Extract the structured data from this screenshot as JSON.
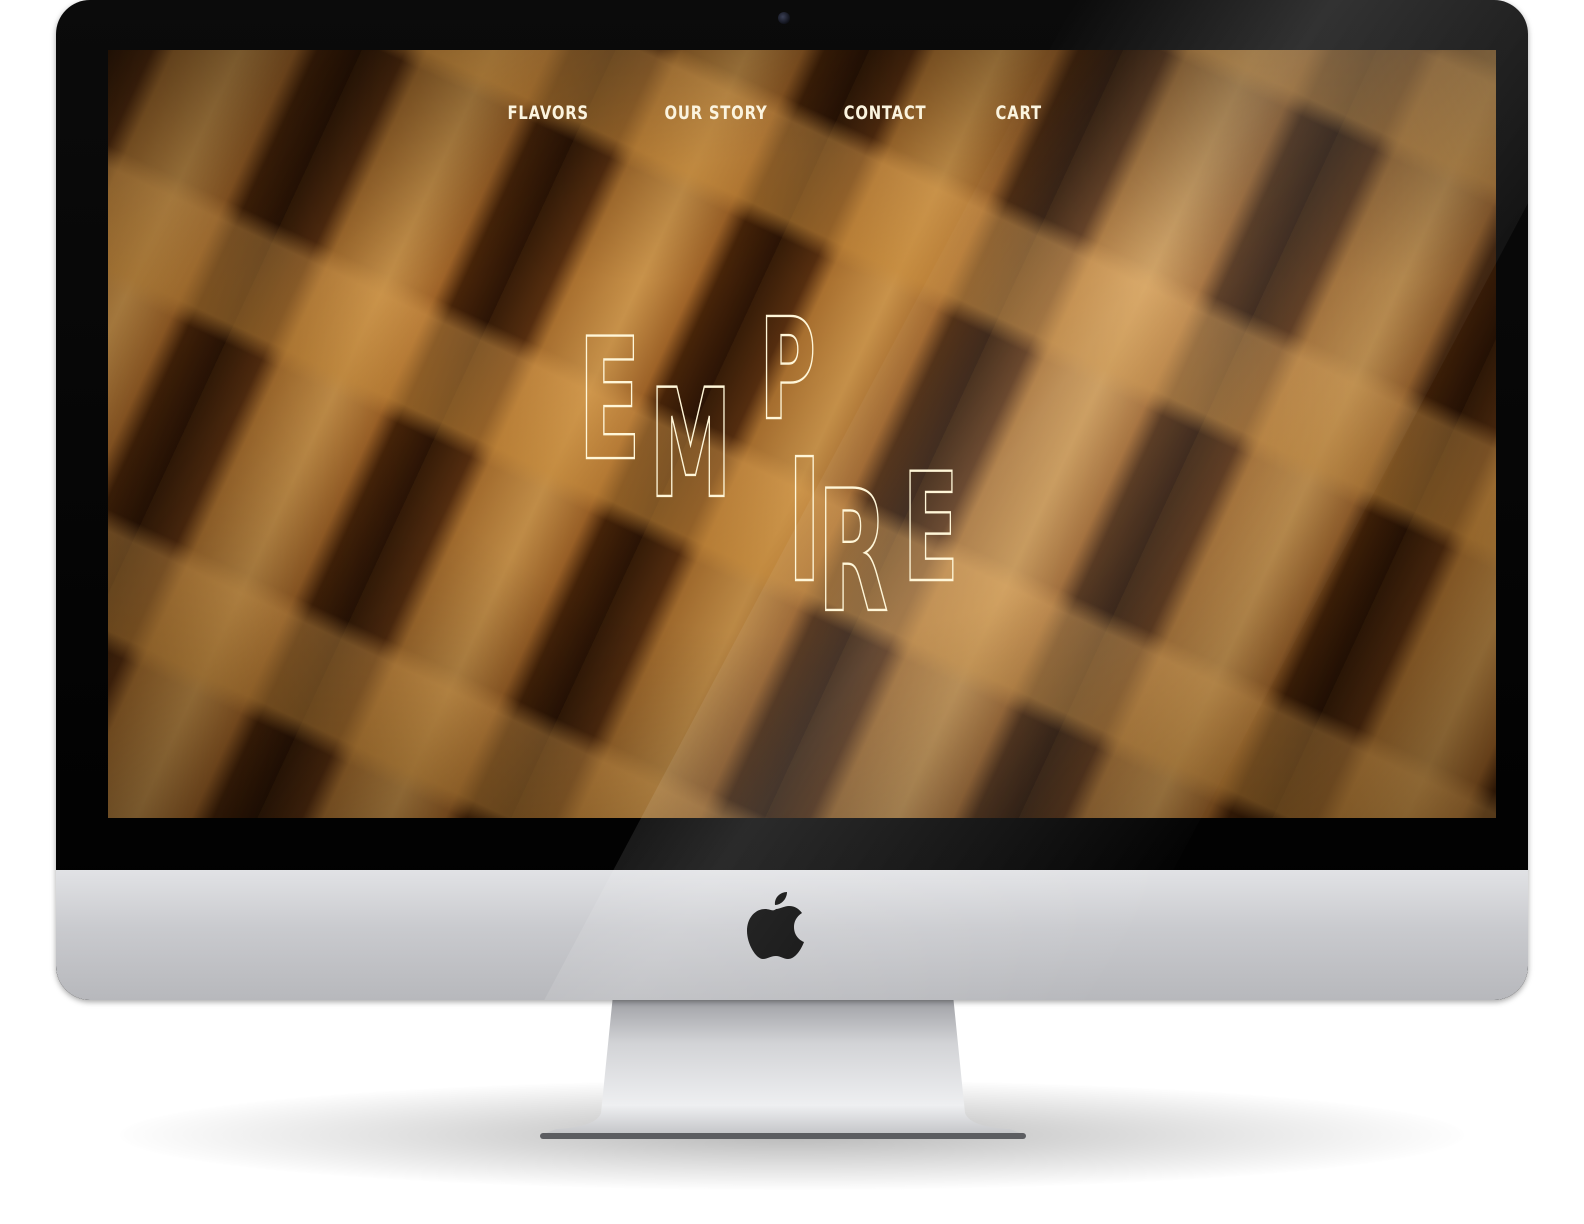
{
  "nav": {
    "items": [
      {
        "label": "FLAVORS"
      },
      {
        "label": "OUR STORY"
      },
      {
        "label": "CONTACT"
      },
      {
        "label": "CART"
      }
    ]
  },
  "hero": {
    "logo_letters": [
      "E",
      "M",
      "P",
      "I",
      "R",
      "E"
    ]
  },
  "colors": {
    "nav_text": "#fbf4df",
    "logo_outline": "#fff6d8",
    "bezel": "#000000",
    "chin": "#c9cace"
  },
  "icons": {
    "brand": "apple-logo-icon",
    "camera": "camera-icon"
  }
}
